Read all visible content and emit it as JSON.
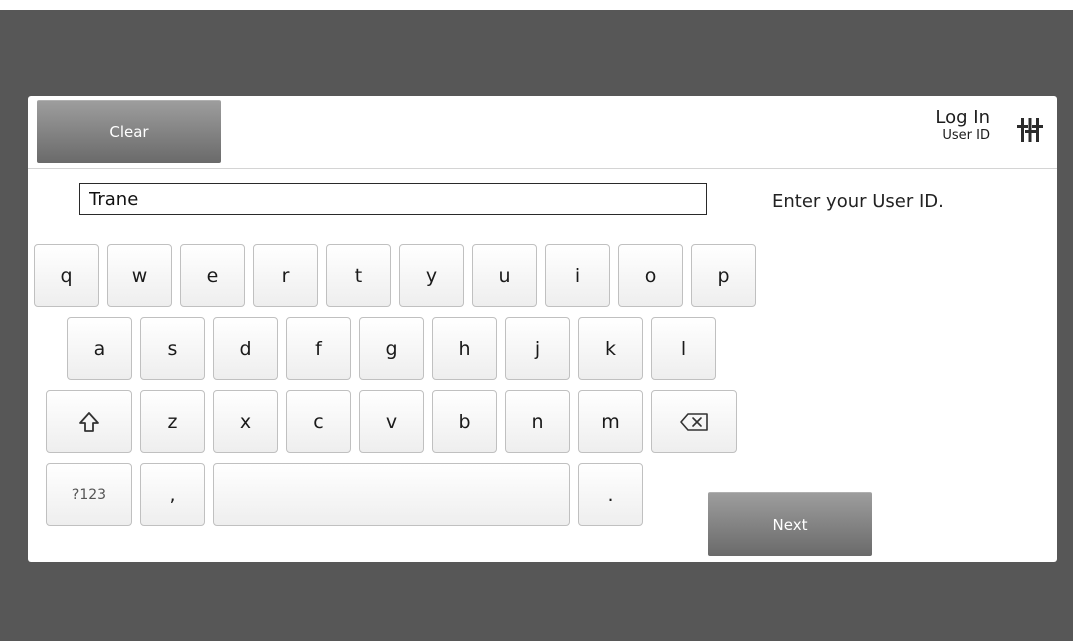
{
  "header": {
    "clear_label": "Clear",
    "title": "Log In",
    "subtitle": "User ID",
    "menu_icon": "tune-icon"
  },
  "userid_field": {
    "value": "Trane"
  },
  "instruction": "Enter your User ID.",
  "keyboard": {
    "row1": [
      "q",
      "w",
      "e",
      "r",
      "t",
      "y",
      "u",
      "i",
      "o",
      "p"
    ],
    "row2": [
      "a",
      "s",
      "d",
      "f",
      "g",
      "h",
      "j",
      "k",
      "l"
    ],
    "row3": [
      "z",
      "x",
      "c",
      "v",
      "b",
      "n",
      "m"
    ],
    "shift_icon": "shift-icon",
    "backspace_icon": "backspace-icon",
    "symbols_label": "?123",
    "comma_label": ",",
    "period_label": "."
  },
  "next_label": "Next",
  "colors": {
    "background": "#575757",
    "panel": "#ffffff",
    "dark_button_top": "#9d9d9d",
    "dark_button_bottom": "#6a6a6a"
  }
}
